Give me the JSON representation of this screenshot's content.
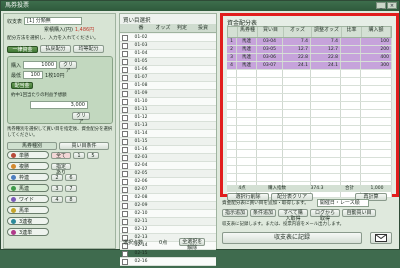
{
  "window": {
    "title": "馬券投票"
  },
  "left": {
    "category_label": "収支表",
    "category_value": "[1] 分類無",
    "balance_label": "累積購入(円)",
    "balance_value": "1,486円",
    "instruction": "配分方法を選択し、入力を入れてください。",
    "method_buttons": [
      "一律資金",
      "払戻配分",
      "均等配分"
    ],
    "amount_label": "購入",
    "amount_value": "1000",
    "clear": "クリア",
    "min_bet_label": "最低",
    "min_bet_value": "100",
    "payout_label": "1枚10円",
    "per_label": "配当金",
    "target_label": "約中1回当たりの利益予想額",
    "target_value": "3,000",
    "target_clear": "クリア",
    "note": "馬券種別を選択して買い目を指定後、資金配分を選択してください。",
    "tabs": [
      "馬券種別",
      "買い目条件"
    ],
    "bet_types": [
      {
        "label": "単勝",
        "color": "#b84a3a"
      },
      {
        "label": "複勝",
        "color": "#d48a2f"
      },
      {
        "label": "枠連",
        "color": "#4d7fbf"
      },
      {
        "label": "馬連",
        "color": "#3f9a4a"
      },
      {
        "label": "ワイド",
        "color": "#7a5ab8"
      },
      {
        "label": "馬単",
        "color": "#c4a52c"
      },
      {
        "label": "3連複",
        "color": "#2c8a9a"
      },
      {
        "label": "3連単",
        "color": "#b03a8a"
      }
    ],
    "option_all": "全て",
    "option_designated": "指定あり",
    "step_values": [
      "1",
      "2",
      "3",
      "4",
      "5",
      "6",
      "7",
      "8"
    ]
  },
  "middle": {
    "title": "買い目選択",
    "columns": [
      "",
      "番",
      "オッズ",
      "判定",
      "投資"
    ],
    "rows": [
      [
        "01-02",
        "",
        ""
      ],
      [
        "01-03",
        "",
        ""
      ],
      [
        "01-04",
        "",
        ""
      ],
      [
        "01-05",
        "",
        ""
      ],
      [
        "01-06",
        "",
        ""
      ],
      [
        "01-07",
        "",
        ""
      ],
      [
        "01-08",
        "",
        ""
      ],
      [
        "01-09",
        "",
        ""
      ],
      [
        "01-10",
        "",
        ""
      ],
      [
        "01-11",
        "",
        ""
      ],
      [
        "01-12",
        "",
        ""
      ],
      [
        "01-13",
        "",
        ""
      ],
      [
        "01-14",
        "",
        ""
      ],
      [
        "01-15",
        "",
        ""
      ],
      [
        "01-16",
        "",
        ""
      ],
      [
        "02-03",
        "",
        ""
      ],
      [
        "02-04",
        "",
        ""
      ],
      [
        "02-05",
        "",
        ""
      ],
      [
        "02-06",
        "",
        ""
      ],
      [
        "02-07",
        "",
        ""
      ],
      [
        "02-08",
        "",
        ""
      ],
      [
        "02-09",
        "",
        ""
      ],
      [
        "02-10",
        "",
        ""
      ],
      [
        "02-11",
        "",
        ""
      ],
      [
        "02-12",
        "",
        ""
      ],
      [
        "02-13",
        "",
        ""
      ],
      [
        "02-14",
        "",
        ""
      ],
      [
        "02-15",
        "",
        ""
      ],
      [
        "02-16",
        "",
        ""
      ]
    ],
    "selected_label": "選択点数",
    "selected_value": "0点",
    "clear_all": "全選択を解除"
  },
  "right": {
    "title": "資金配分表",
    "columns": [
      "馬券種",
      "買い目",
      "オッズ",
      "調整オッズ",
      "比率",
      "購入額"
    ],
    "rows": [
      {
        "no": "1",
        "type": "馬連",
        "combo": "03-04",
        "odds": "7.4",
        "adj": "7.4",
        "ratio": "",
        "amount": "100"
      },
      {
        "no": "2",
        "type": "馬連",
        "combo": "03-05",
        "odds": "12.7",
        "adj": "12.7",
        "ratio": "",
        "amount": "200"
      },
      {
        "no": "3",
        "type": "馬連",
        "combo": "03-06",
        "odds": "22.8",
        "adj": "22.8",
        "ratio": "",
        "amount": "400"
      },
      {
        "no": "4",
        "type": "馬連",
        "combo": "03-07",
        "odds": "24.1",
        "adj": "24.1",
        "ratio": "",
        "amount": "300"
      }
    ],
    "footer": {
      "count": "4点",
      "label": "購入指数",
      "index": "374.3",
      "total_label": "合計",
      "total": "1,000"
    },
    "buttons": [
      "選択行削除",
      "配分表クリア",
      "再計算"
    ]
  },
  "bottom_right": {
    "note": "資金配分表に買い目を追加・取得します。",
    "sort": "開催日・レース順",
    "buttons": [
      "指示追加",
      "条件追加",
      "すべて購入取得",
      "ログから取得",
      "自動買い目"
    ],
    "help_text": "収支表に記録します。または、投票内容をメール出力します。",
    "record": "収支表に記録",
    "mail_icon": "mail-icon"
  }
}
